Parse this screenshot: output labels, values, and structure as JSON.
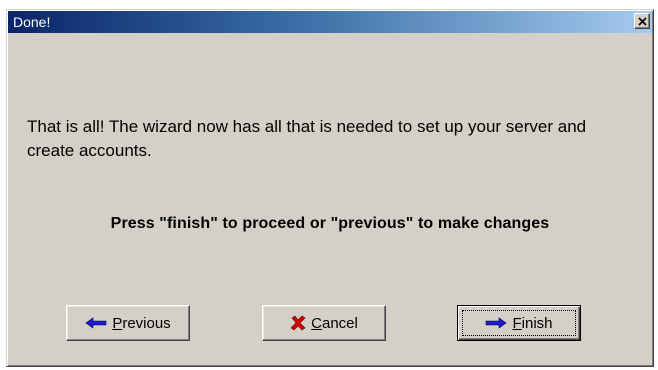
{
  "window": {
    "title": "Done!"
  },
  "message": "That is all! The wizard now has all that is needed to set up your server and create accounts.",
  "instruction": "Press \"finish\" to proceed or \"previous\" to make changes",
  "buttons": {
    "previous": {
      "accel": "P",
      "rest": "revious",
      "icon": "arrow-left-icon"
    },
    "cancel": {
      "accel": "C",
      "rest": "ancel",
      "icon": "red-x-icon"
    },
    "finish": {
      "accel": "F",
      "rest": "inish",
      "icon": "arrow-right-icon"
    }
  },
  "colors": {
    "title_gradient_start": "#0a246a",
    "title_gradient_end": "#a6caf0",
    "dialog_face": "#d4d0c8",
    "arrow_blue": "#1c1cc8",
    "cancel_red": "#d40000"
  }
}
